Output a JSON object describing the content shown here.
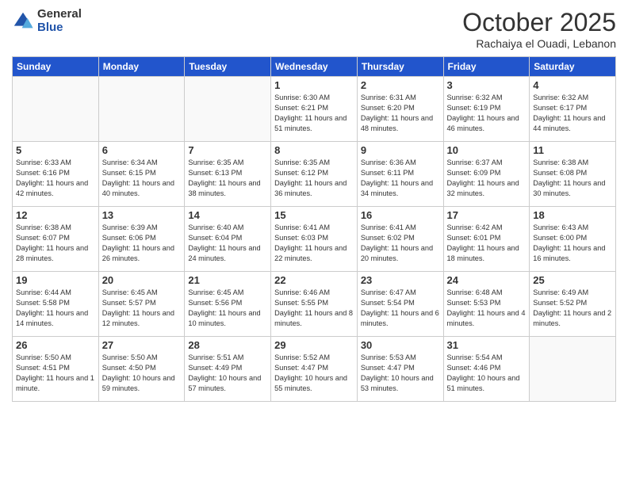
{
  "header": {
    "logo_general": "General",
    "logo_blue": "Blue",
    "month_title": "October 2025",
    "subtitle": "Rachaiya el Ouadi, Lebanon"
  },
  "weekdays": [
    "Sunday",
    "Monday",
    "Tuesday",
    "Wednesday",
    "Thursday",
    "Friday",
    "Saturday"
  ],
  "weeks": [
    [
      {
        "day": "",
        "content": ""
      },
      {
        "day": "",
        "content": ""
      },
      {
        "day": "",
        "content": ""
      },
      {
        "day": "1",
        "content": "Sunrise: 6:30 AM\nSunset: 6:21 PM\nDaylight: 11 hours\nand 51 minutes."
      },
      {
        "day": "2",
        "content": "Sunrise: 6:31 AM\nSunset: 6:20 PM\nDaylight: 11 hours\nand 48 minutes."
      },
      {
        "day": "3",
        "content": "Sunrise: 6:32 AM\nSunset: 6:19 PM\nDaylight: 11 hours\nand 46 minutes."
      },
      {
        "day": "4",
        "content": "Sunrise: 6:32 AM\nSunset: 6:17 PM\nDaylight: 11 hours\nand 44 minutes."
      }
    ],
    [
      {
        "day": "5",
        "content": "Sunrise: 6:33 AM\nSunset: 6:16 PM\nDaylight: 11 hours\nand 42 minutes."
      },
      {
        "day": "6",
        "content": "Sunrise: 6:34 AM\nSunset: 6:15 PM\nDaylight: 11 hours\nand 40 minutes."
      },
      {
        "day": "7",
        "content": "Sunrise: 6:35 AM\nSunset: 6:13 PM\nDaylight: 11 hours\nand 38 minutes."
      },
      {
        "day": "8",
        "content": "Sunrise: 6:35 AM\nSunset: 6:12 PM\nDaylight: 11 hours\nand 36 minutes."
      },
      {
        "day": "9",
        "content": "Sunrise: 6:36 AM\nSunset: 6:11 PM\nDaylight: 11 hours\nand 34 minutes."
      },
      {
        "day": "10",
        "content": "Sunrise: 6:37 AM\nSunset: 6:09 PM\nDaylight: 11 hours\nand 32 minutes."
      },
      {
        "day": "11",
        "content": "Sunrise: 6:38 AM\nSunset: 6:08 PM\nDaylight: 11 hours\nand 30 minutes."
      }
    ],
    [
      {
        "day": "12",
        "content": "Sunrise: 6:38 AM\nSunset: 6:07 PM\nDaylight: 11 hours\nand 28 minutes."
      },
      {
        "day": "13",
        "content": "Sunrise: 6:39 AM\nSunset: 6:06 PM\nDaylight: 11 hours\nand 26 minutes."
      },
      {
        "day": "14",
        "content": "Sunrise: 6:40 AM\nSunset: 6:04 PM\nDaylight: 11 hours\nand 24 minutes."
      },
      {
        "day": "15",
        "content": "Sunrise: 6:41 AM\nSunset: 6:03 PM\nDaylight: 11 hours\nand 22 minutes."
      },
      {
        "day": "16",
        "content": "Sunrise: 6:41 AM\nSunset: 6:02 PM\nDaylight: 11 hours\nand 20 minutes."
      },
      {
        "day": "17",
        "content": "Sunrise: 6:42 AM\nSunset: 6:01 PM\nDaylight: 11 hours\nand 18 minutes."
      },
      {
        "day": "18",
        "content": "Sunrise: 6:43 AM\nSunset: 6:00 PM\nDaylight: 11 hours\nand 16 minutes."
      }
    ],
    [
      {
        "day": "19",
        "content": "Sunrise: 6:44 AM\nSunset: 5:58 PM\nDaylight: 11 hours\nand 14 minutes."
      },
      {
        "day": "20",
        "content": "Sunrise: 6:45 AM\nSunset: 5:57 PM\nDaylight: 11 hours\nand 12 minutes."
      },
      {
        "day": "21",
        "content": "Sunrise: 6:45 AM\nSunset: 5:56 PM\nDaylight: 11 hours\nand 10 minutes."
      },
      {
        "day": "22",
        "content": "Sunrise: 6:46 AM\nSunset: 5:55 PM\nDaylight: 11 hours\nand 8 minutes."
      },
      {
        "day": "23",
        "content": "Sunrise: 6:47 AM\nSunset: 5:54 PM\nDaylight: 11 hours\nand 6 minutes."
      },
      {
        "day": "24",
        "content": "Sunrise: 6:48 AM\nSunset: 5:53 PM\nDaylight: 11 hours\nand 4 minutes."
      },
      {
        "day": "25",
        "content": "Sunrise: 6:49 AM\nSunset: 5:52 PM\nDaylight: 11 hours\nand 2 minutes."
      }
    ],
    [
      {
        "day": "26",
        "content": "Sunrise: 5:50 AM\nSunset: 4:51 PM\nDaylight: 11 hours\nand 1 minute."
      },
      {
        "day": "27",
        "content": "Sunrise: 5:50 AM\nSunset: 4:50 PM\nDaylight: 10 hours\nand 59 minutes."
      },
      {
        "day": "28",
        "content": "Sunrise: 5:51 AM\nSunset: 4:49 PM\nDaylight: 10 hours\nand 57 minutes."
      },
      {
        "day": "29",
        "content": "Sunrise: 5:52 AM\nSunset: 4:47 PM\nDaylight: 10 hours\nand 55 minutes."
      },
      {
        "day": "30",
        "content": "Sunrise: 5:53 AM\nSunset: 4:47 PM\nDaylight: 10 hours\nand 53 minutes."
      },
      {
        "day": "31",
        "content": "Sunrise: 5:54 AM\nSunset: 4:46 PM\nDaylight: 10 hours\nand 51 minutes."
      },
      {
        "day": "",
        "content": ""
      }
    ]
  ]
}
